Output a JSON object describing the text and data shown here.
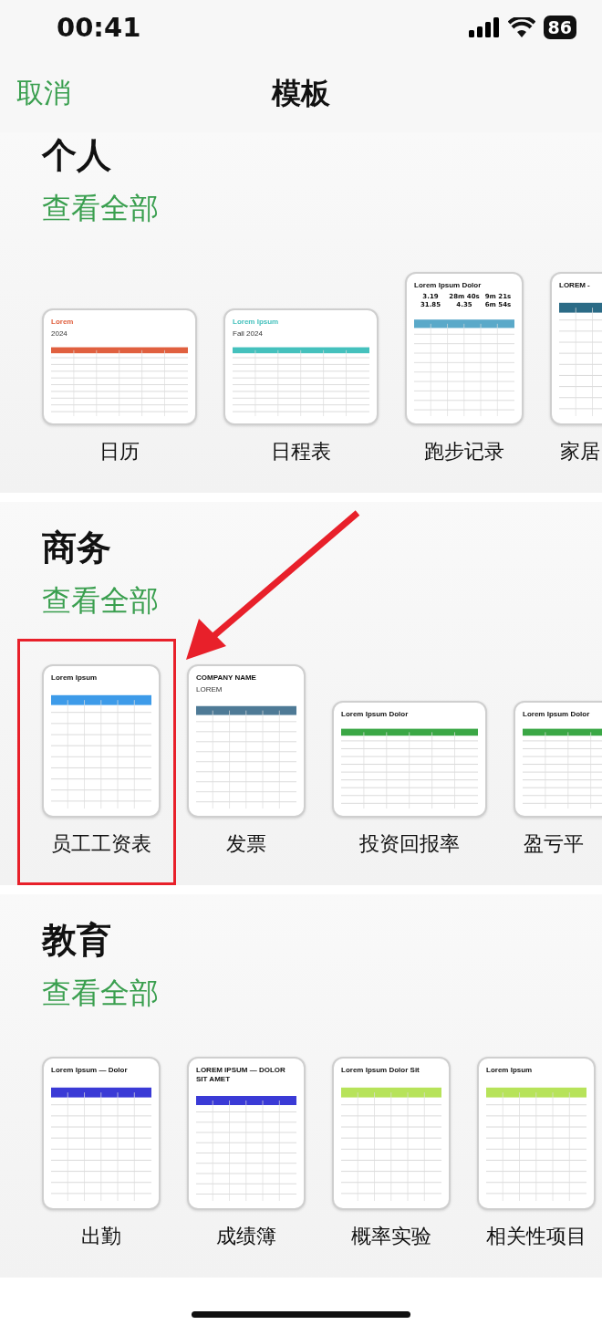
{
  "status_bar": {
    "time": "00:41",
    "battery": "86"
  },
  "nav": {
    "cancel": "取消",
    "title": "模板"
  },
  "sections": [
    {
      "title": "个人",
      "see_all": "查看全部",
      "templates": [
        {
          "name": "日历",
          "kind": "landscape",
          "title": "Lorem",
          "subtitle": "2024",
          "color": "#e0603f",
          "highlighted": false
        },
        {
          "name": "日程表",
          "kind": "landscape",
          "title": "Lorem Ipsum",
          "subtitle": "Fall 2024",
          "color": "#45c1bd",
          "highlighted": false
        },
        {
          "name": "跑步记录",
          "kind": "portrait",
          "title": "Lorem Ipsum Dolor",
          "color": "#5aa9c9",
          "stats": [
            "3.19",
            "28m 40s",
            "9m 21s",
            "31.85",
            "4.35",
            "6m 54s"
          ],
          "highlighted": false
        },
        {
          "name": "家居",
          "kind": "portrait",
          "title": "LOREM -",
          "color": "#2b6b86",
          "highlighted": false
        }
      ]
    },
    {
      "title": "商务",
      "see_all": "查看全部",
      "templates": [
        {
          "name": "员工工资表",
          "kind": "portrait",
          "title": "Lorem Ipsum",
          "color": "#3d9be9",
          "highlighted": true
        },
        {
          "name": "发票",
          "kind": "portrait",
          "title": "COMPANY NAME",
          "subtitle": "LOREM",
          "color": "#4e7a96",
          "highlighted": false
        },
        {
          "name": "投资回报率",
          "kind": "landscape",
          "title": "Lorem Ipsum Dolor",
          "color": "#3aa745",
          "highlighted": false
        },
        {
          "name": "盈亏平",
          "kind": "landscape",
          "title": "Lorem Ipsum Dolor",
          "color": "#3aa745",
          "highlighted": false
        }
      ]
    },
    {
      "title": "教育",
      "see_all": "查看全部",
      "templates": [
        {
          "name": "出勤",
          "kind": "portrait",
          "title": "Lorem Ipsum — Dolor",
          "color": "#3a3ad6",
          "highlighted": false
        },
        {
          "name": "成绩簿",
          "kind": "portrait",
          "title": "LOREM IPSUM — DOLOR SIT AMET",
          "color": "#3a3ad6",
          "highlighted": false
        },
        {
          "name": "概率实验",
          "kind": "portrait",
          "title": "Lorem Ipsum Dolor Sit",
          "color": "#b7e35a",
          "highlighted": false
        },
        {
          "name": "相关性项目",
          "kind": "portrait",
          "title": "Lorem Ipsum",
          "color": "#b7e35a",
          "highlighted": false
        }
      ]
    }
  ]
}
